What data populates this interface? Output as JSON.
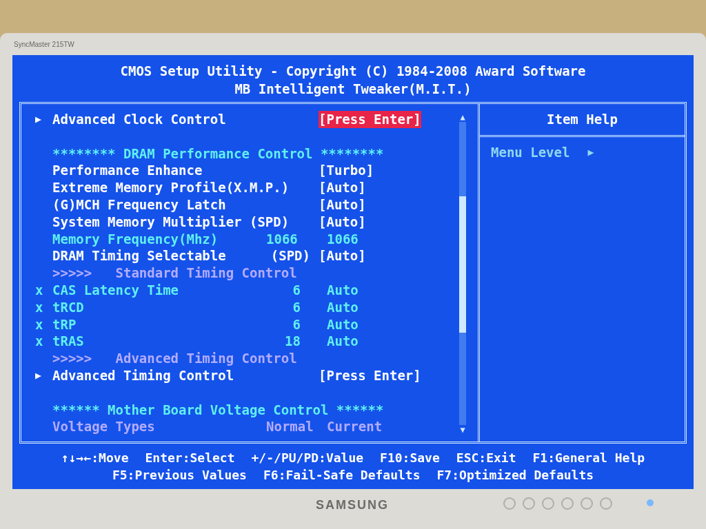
{
  "monitor": {
    "model": "SyncMaster 215TW",
    "brand": "SAMSUNG"
  },
  "title_lines": [
    "CMOS Setup Utility - Copyright (C) 1984-2008 Award Software",
    "MB Intelligent Tweaker(M.I.T.)"
  ],
  "items": [
    {
      "kind": "submenu",
      "marker": "▶",
      "label": "Advanced Clock Control",
      "value": "[Press Enter]",
      "selected": true,
      "disabled": false
    },
    {
      "kind": "blank"
    },
    {
      "kind": "heading",
      "label": "******** DRAM Performance Control ********",
      "disabled": false
    },
    {
      "kind": "setting",
      "label": "Performance Enhance",
      "value": "[Turbo]",
      "selected": false,
      "disabled": false
    },
    {
      "kind": "setting",
      "label": "Extreme Memory Profile(X.M.P.)",
      "value": "[Auto]",
      "selected": false,
      "disabled": false
    },
    {
      "kind": "setting",
      "label": "(G)MCH Frequency Latch",
      "value": "[Auto]",
      "selected": false,
      "disabled": false
    },
    {
      "kind": "setting",
      "label": "System Memory Multiplier (SPD)",
      "value": "[Auto]",
      "selected": false,
      "disabled": false
    },
    {
      "kind": "readout",
      "label": "Memory Frequency(Mhz)",
      "value": "1066",
      "value2": "1066",
      "disabled": false
    },
    {
      "kind": "setting",
      "label": "DRAM Timing Selectable",
      "tag": "(SPD)",
      "value": "[Auto]",
      "selected": false,
      "disabled": false
    },
    {
      "kind": "heading",
      "label": ">>>>>   Standard Timing Control",
      "disabled": true
    },
    {
      "kind": "locked",
      "marker": "x",
      "label": "CAS Latency Time",
      "value": "6",
      "value2": "Auto",
      "disabled": false
    },
    {
      "kind": "locked",
      "marker": "x",
      "label": "tRCD",
      "value": "6",
      "value2": "Auto",
      "disabled": false
    },
    {
      "kind": "locked",
      "marker": "x",
      "label": "tRP",
      "value": "6",
      "value2": "Auto",
      "disabled": false
    },
    {
      "kind": "locked",
      "marker": "x",
      "label": "tRAS",
      "value": "18",
      "value2": "Auto",
      "disabled": false
    },
    {
      "kind": "heading",
      "label": ">>>>>   Advanced Timing Control",
      "disabled": true
    },
    {
      "kind": "submenu",
      "marker": "▶",
      "label": "Advanced Timing Control",
      "value": "[Press Enter]",
      "selected": false,
      "disabled": false
    },
    {
      "kind": "blank"
    },
    {
      "kind": "heading",
      "label": "****** Mother Board Voltage Control ******",
      "disabled": false
    },
    {
      "kind": "readout",
      "label": "Voltage Types",
      "value": "Normal",
      "value2": "Current",
      "disabled": true
    }
  ],
  "scrollbar": {
    "up": "▲",
    "down": "▼"
  },
  "help_panel": {
    "title": "Item Help",
    "menu_level_label": "Menu Level",
    "menu_level_marker": "▶"
  },
  "footer_lines": [
    [
      "↑↓→←:Move",
      "Enter:Select",
      "+/-/PU/PD:Value",
      "F10:Save",
      "ESC:Exit",
      "F1:General Help"
    ],
    [
      "F5:Previous Values",
      "F6:Fail-Safe Defaults",
      "F7:Optimized Defaults"
    ]
  ]
}
